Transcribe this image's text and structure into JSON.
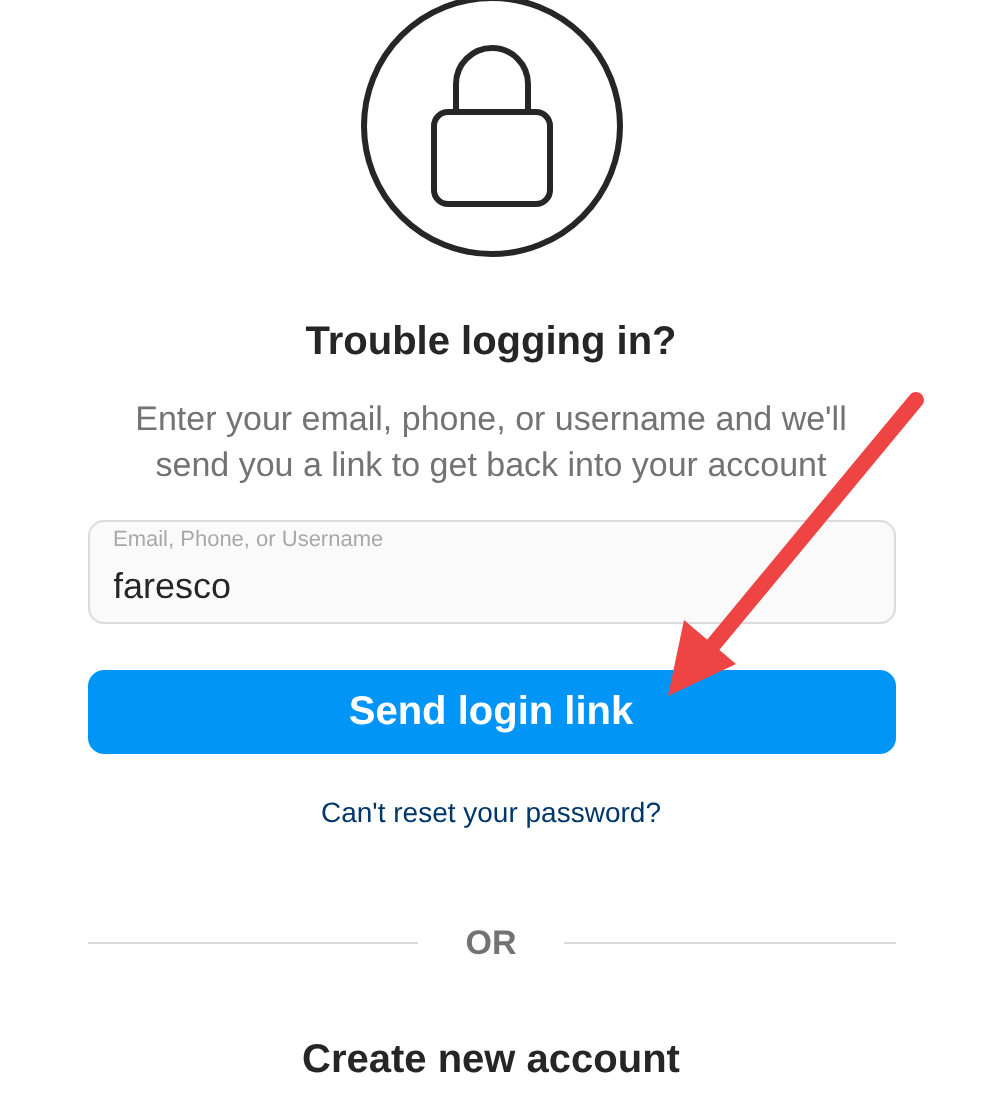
{
  "title": "Trouble logging in?",
  "description": "Enter your email, phone, or username and we'll send you a link to get back into your account",
  "field": {
    "label": "Email, Phone, or Username",
    "value": "faresco"
  },
  "send_button": "Send login link",
  "reset_link": "Can't reset your password?",
  "divider": "OR",
  "create_account": "Create new account"
}
